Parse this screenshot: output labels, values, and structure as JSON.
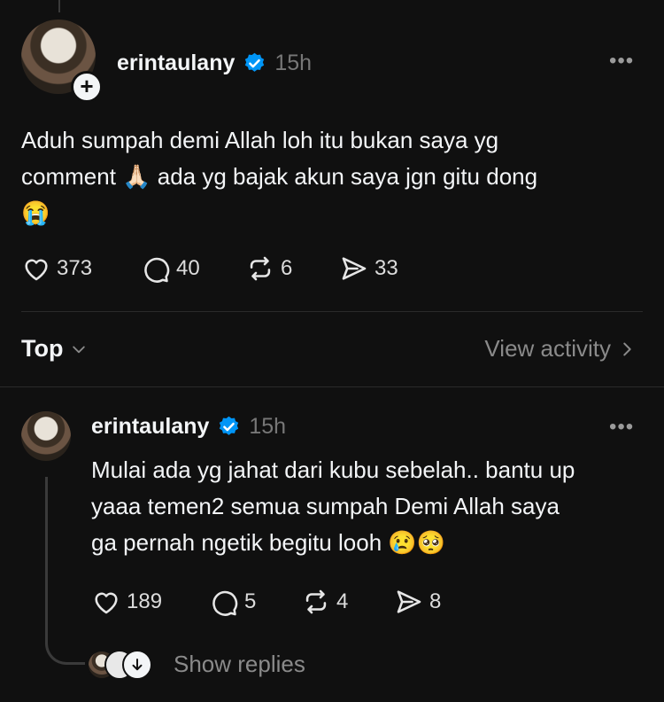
{
  "post": {
    "username": "erintaulany",
    "time": "15h",
    "text_line1": "Aduh sumpah demi Allah loh itu bukan saya yg",
    "text_line2_a": "comment",
    "text_line2_emoji": "🙏🏻",
    "text_line2_b": "ada yg bajak akun saya jgn gitu dong",
    "text_line3_emoji": "😭",
    "likes": "373",
    "comments": "40",
    "reposts": "6",
    "shares": "33"
  },
  "sort": {
    "label": "Top",
    "view_activity": "View activity"
  },
  "reply": {
    "username": "erintaulany",
    "time": "15h",
    "line1": "Mulai ada yg jahat dari kubu sebelah.. bantu up",
    "line2": "yaaa temen2 semua sumpah Demi Allah saya",
    "line3": "ga pernah ngetik begitu looh",
    "line3_emoji": "😢🥺",
    "likes": "189",
    "comments": "5",
    "reposts": "4",
    "shares": "8",
    "show_replies": "Show replies"
  },
  "colors": {
    "background": "#101010",
    "text": "#f3f5f7",
    "muted": "#777777",
    "verified": "#0095f6"
  },
  "icons": [
    "verified-badge-icon",
    "more-icon",
    "heart-icon",
    "comment-icon",
    "repost-icon",
    "share-icon",
    "chevron-down-icon",
    "chevron-right-icon",
    "arrow-down-icon",
    "plus-icon"
  ]
}
